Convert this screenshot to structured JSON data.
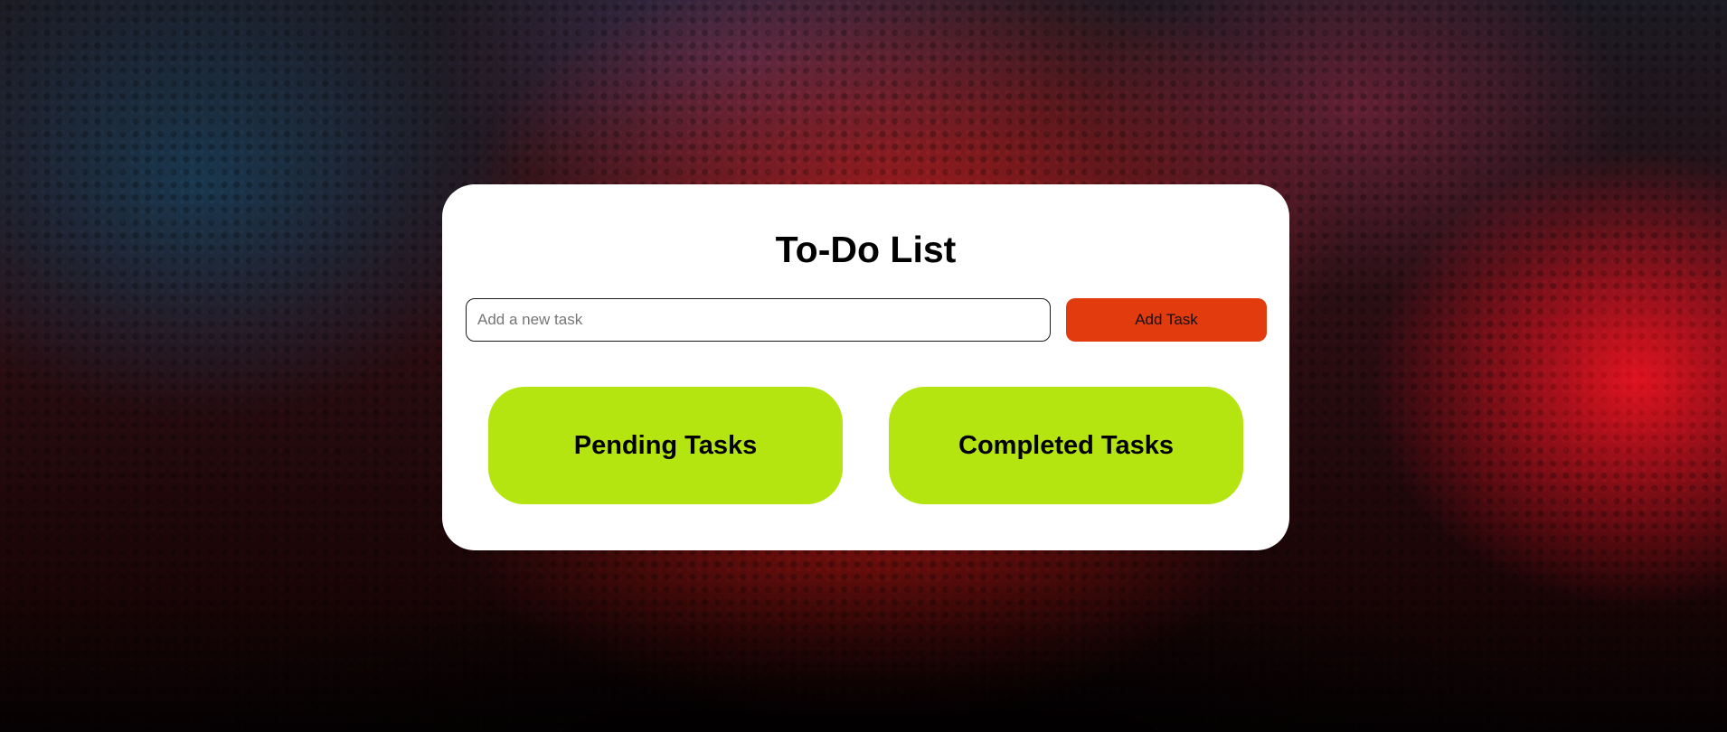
{
  "app": {
    "title": "To-Do List"
  },
  "form": {
    "input_value": "",
    "input_placeholder": "Add a new task",
    "add_button_label": "Add Task"
  },
  "panels": {
    "pending": {
      "title": "Pending Tasks"
    },
    "completed": {
      "title": "Completed Tasks"
    }
  },
  "colors": {
    "card_background": "#ffffff",
    "add_button": "#e23b0e",
    "panel_background": "#b5e510"
  }
}
